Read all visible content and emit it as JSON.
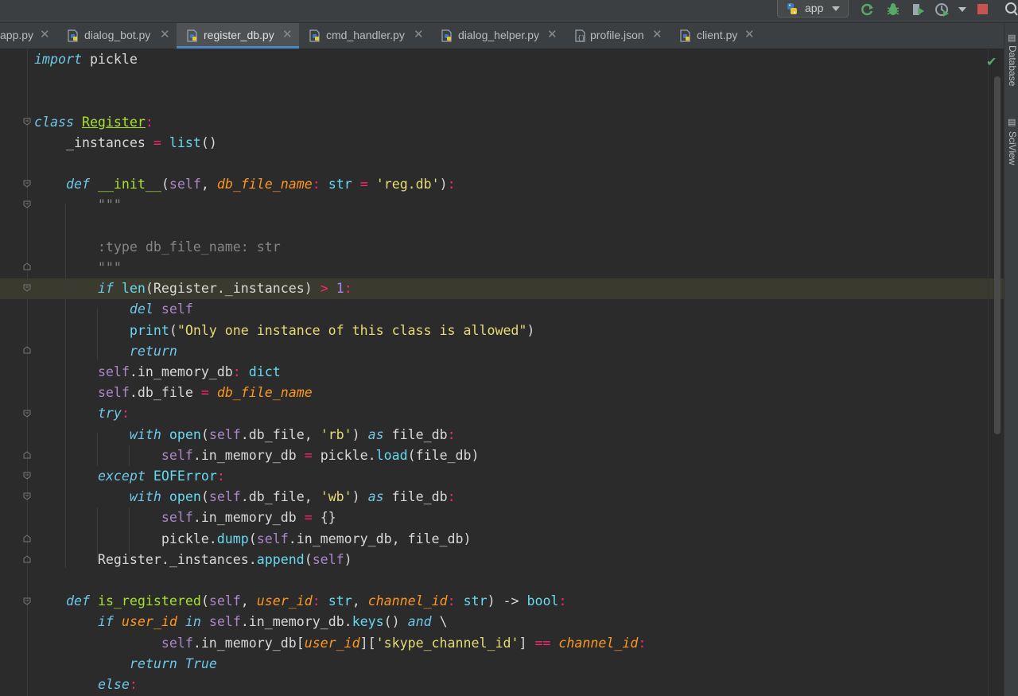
{
  "toolbar": {
    "run_config_label": "app",
    "icons": [
      "python-icon",
      "rerun-icon",
      "debug-icon",
      "coverage-icon",
      "profile-icon",
      "more-run-icon",
      "stop-icon",
      "search-icon"
    ]
  },
  "tabs": [
    {
      "label": "app.py",
      "icon": "python-file-icon",
      "active": false
    },
    {
      "label": "dialog_bot.py",
      "icon": "python-file-icon",
      "active": false
    },
    {
      "label": "register_db.py",
      "icon": "python-file-icon",
      "active": true
    },
    {
      "label": "cmd_handler.py",
      "icon": "python-file-icon",
      "active": false
    },
    {
      "label": "dialog_helper.py",
      "icon": "python-file-icon",
      "active": false
    },
    {
      "label": "profile.json",
      "icon": "json-file-icon",
      "active": false
    },
    {
      "label": "client.py",
      "icon": "python-file-icon",
      "active": false
    }
  ],
  "right_tools": [
    "Database",
    "SciView"
  ],
  "colors": {
    "background": "#2b2b2b",
    "toolbar": "#3c3f41",
    "active_tab_underline": "#4a88c7",
    "caret_line": "#3a3a2e",
    "inspection_ok": "#59a869"
  },
  "editor": {
    "highlighted_line": 12,
    "status_icon": "checkmark-icon",
    "lines": [
      "import pickle",
      "",
      "",
      "class Register:",
      "    _instances = list()",
      "",
      "    def __init__(self, db_file_name: str = 'reg.db'):",
      "        \"\"\"",
      "",
      "        :type db_file_name: str",
      "        \"\"\"",
      "        if len(Register._instances) > 1:",
      "            del self",
      "            print(\"Only one instance of this class is allowed\")",
      "            return",
      "        self.in_memory_db: dict",
      "        self.db_file = db_file_name",
      "        try:",
      "            with open(self.db_file, 'rb') as file_db:",
      "                self.in_memory_db = pickle.load(file_db)",
      "        except EOFError:",
      "            with open(self.db_file, 'wb') as file_db:",
      "                self.in_memory_db = {}",
      "                pickle.dump(self.in_memory_db, file_db)",
      "        Register._instances.append(self)",
      "",
      "    def is_registered(self, user_id: str, channel_id: str) -> bool:",
      "        if user_id in self.in_memory_db.keys() and \\",
      "                self.in_memory_db[user_id]['skype_channel_id'] == channel_id:",
      "            return True",
      "        else:"
    ]
  }
}
